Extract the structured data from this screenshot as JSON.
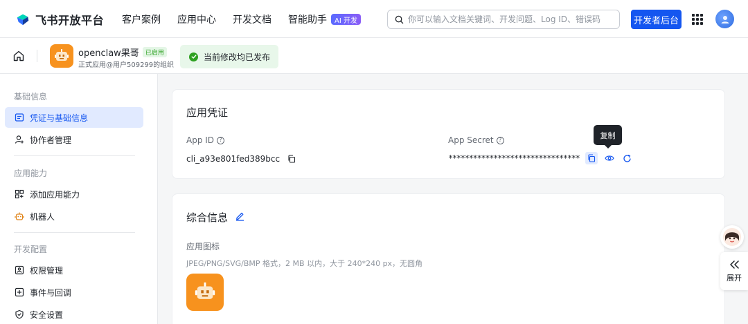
{
  "topnav": {
    "brand": "飞书开放平台",
    "links": [
      "客户案例",
      "应用中心",
      "开发文档",
      "智能助手"
    ],
    "ai_badge": "AI 开发",
    "search_placeholder": "你可以输入文档关键词、开发问题、Log ID、错误码",
    "dev_console": "开发者后台"
  },
  "appbar": {
    "app_name": "openclaw果哥",
    "enabled_tag": "已启用",
    "app_sub": "正式应用@用户509299的组织",
    "status": "当前修改均已发布"
  },
  "sidebar": {
    "sections": [
      {
        "title": "基础信息",
        "items": [
          "凭证与基础信息",
          "协作者管理"
        ]
      },
      {
        "title": "应用能力",
        "items": [
          "添加应用能力",
          "机器人"
        ]
      },
      {
        "title": "开发配置",
        "items": [
          "权限管理",
          "事件与回调",
          "安全设置"
        ]
      }
    ]
  },
  "credentials": {
    "title": "应用凭证",
    "app_id_label": "App ID",
    "app_id_value": "cli_a93e801fed389bcc",
    "secret_label": "App Secret",
    "secret_mask": "********************************",
    "copy_tooltip": "复制"
  },
  "general": {
    "title": "综合信息",
    "icon_label": "应用图标",
    "icon_hint": "JPEG/PNG/SVG/BMP 格式，2 MB 以内，大于 240*240 px，无圆角"
  },
  "float": {
    "expand_label": "展开"
  },
  "colors": {
    "primary": "#1456f0",
    "success": "#2ea121",
    "app_orange": "#f7921e",
    "active_bg": "#e1eaff"
  }
}
